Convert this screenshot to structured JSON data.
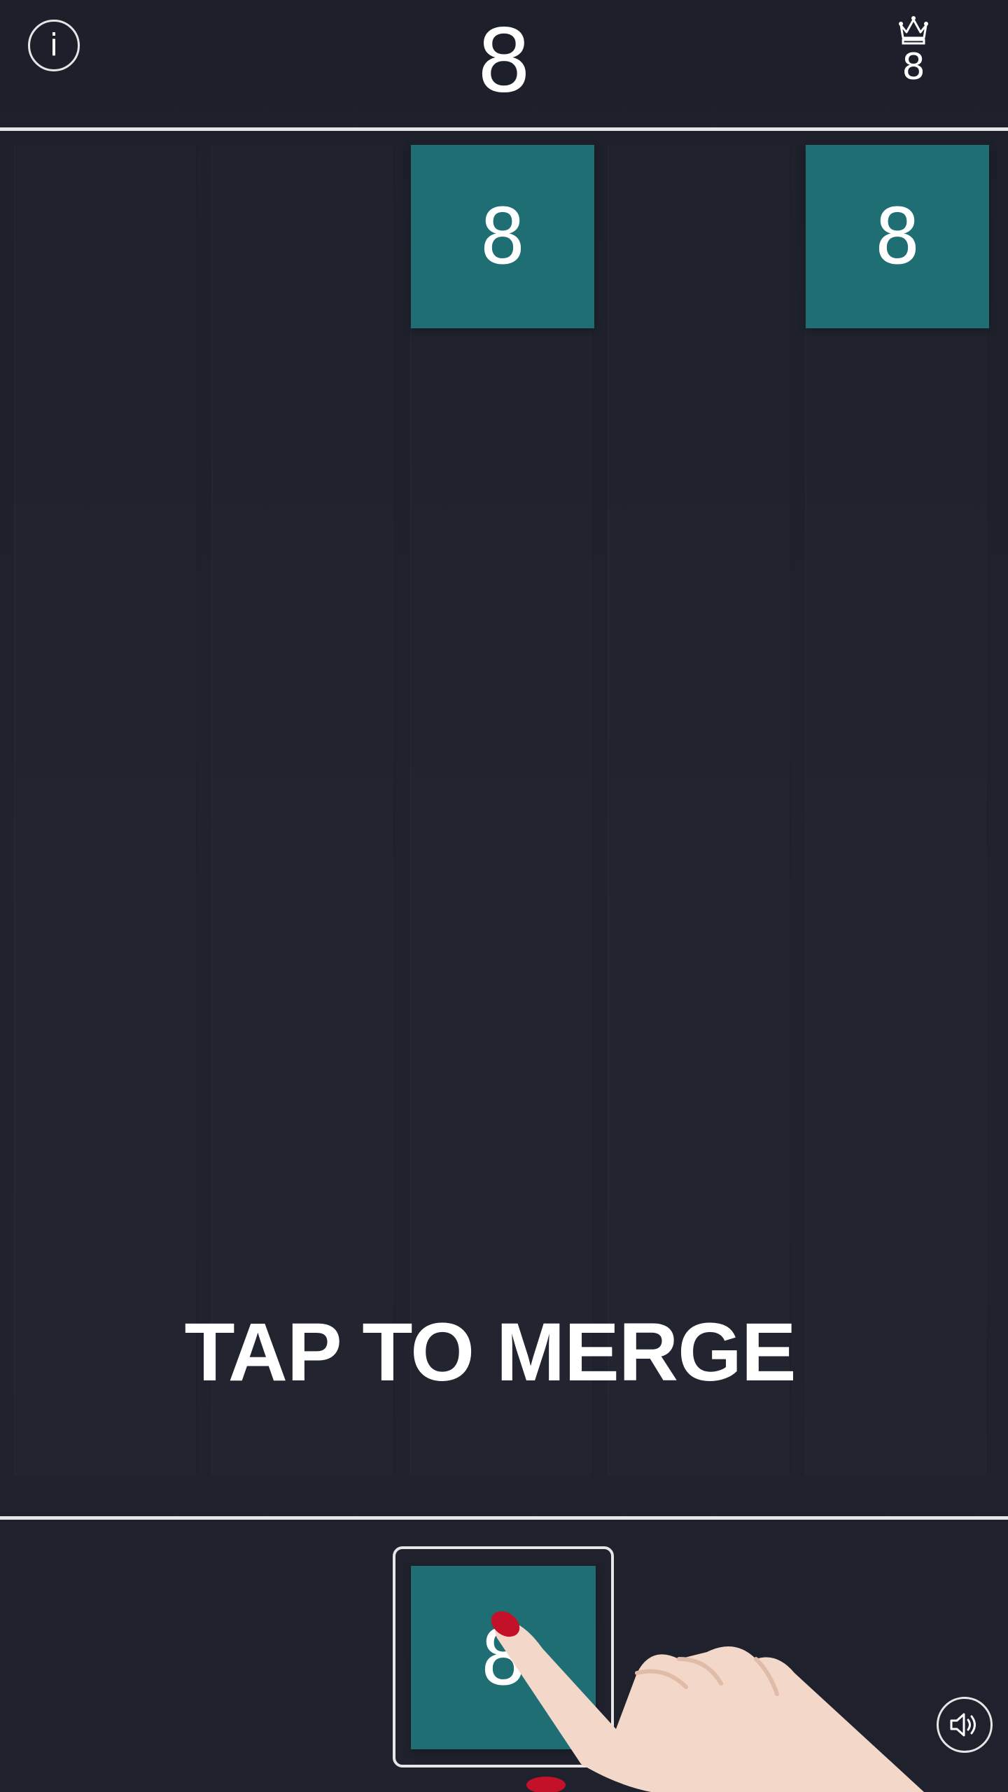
{
  "header": {
    "info_icon": "info-icon",
    "info_label": "i",
    "score": "8",
    "best_icon": "crown-icon",
    "best_score": "8"
  },
  "board": {
    "tiles": [
      {
        "value": "8",
        "column": 3
      },
      {
        "value": "8",
        "column": 5
      }
    ],
    "tile_color": "#1e6e74"
  },
  "hint_text": "TAP TO MERGE",
  "next_tile": {
    "value": "8"
  },
  "footer": {
    "sound_icon": "speaker-icon"
  },
  "colors": {
    "background": "#1f212c",
    "divider": "#e6e6e6",
    "tile": "#1e6e74",
    "text": "#ffffff"
  }
}
